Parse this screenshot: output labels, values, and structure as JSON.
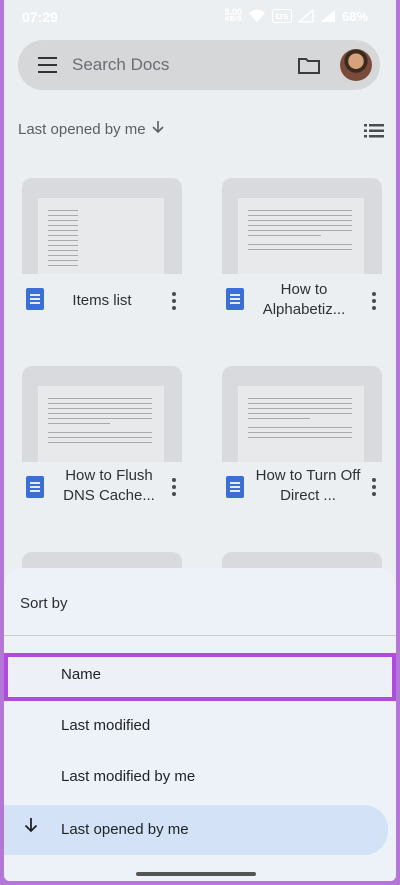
{
  "status_bar": {
    "time": "07:29",
    "speed_value": "5.00",
    "speed_unit": "KB/S",
    "network": "Vo LTE",
    "battery": "68%"
  },
  "search": {
    "placeholder": "Search Docs"
  },
  "sort_header": {
    "label": "Last opened by me"
  },
  "documents": [
    {
      "title": "Items list"
    },
    {
      "title": "How to Alphabetiz..."
    },
    {
      "title": "How to Flush DNS Cache..."
    },
    {
      "title": "How to Turn Off Direct ..."
    }
  ],
  "sheet": {
    "title": "Sort by",
    "options": [
      {
        "label": "Name"
      },
      {
        "label": "Last modified"
      },
      {
        "label": "Last modified by me"
      },
      {
        "label": "Last opened by me",
        "selected": true
      }
    ]
  },
  "colors": {
    "accent_highlight": "#b14be0",
    "doc_icon": "#3b6fd4",
    "selected_option": "#d3e2f6"
  }
}
